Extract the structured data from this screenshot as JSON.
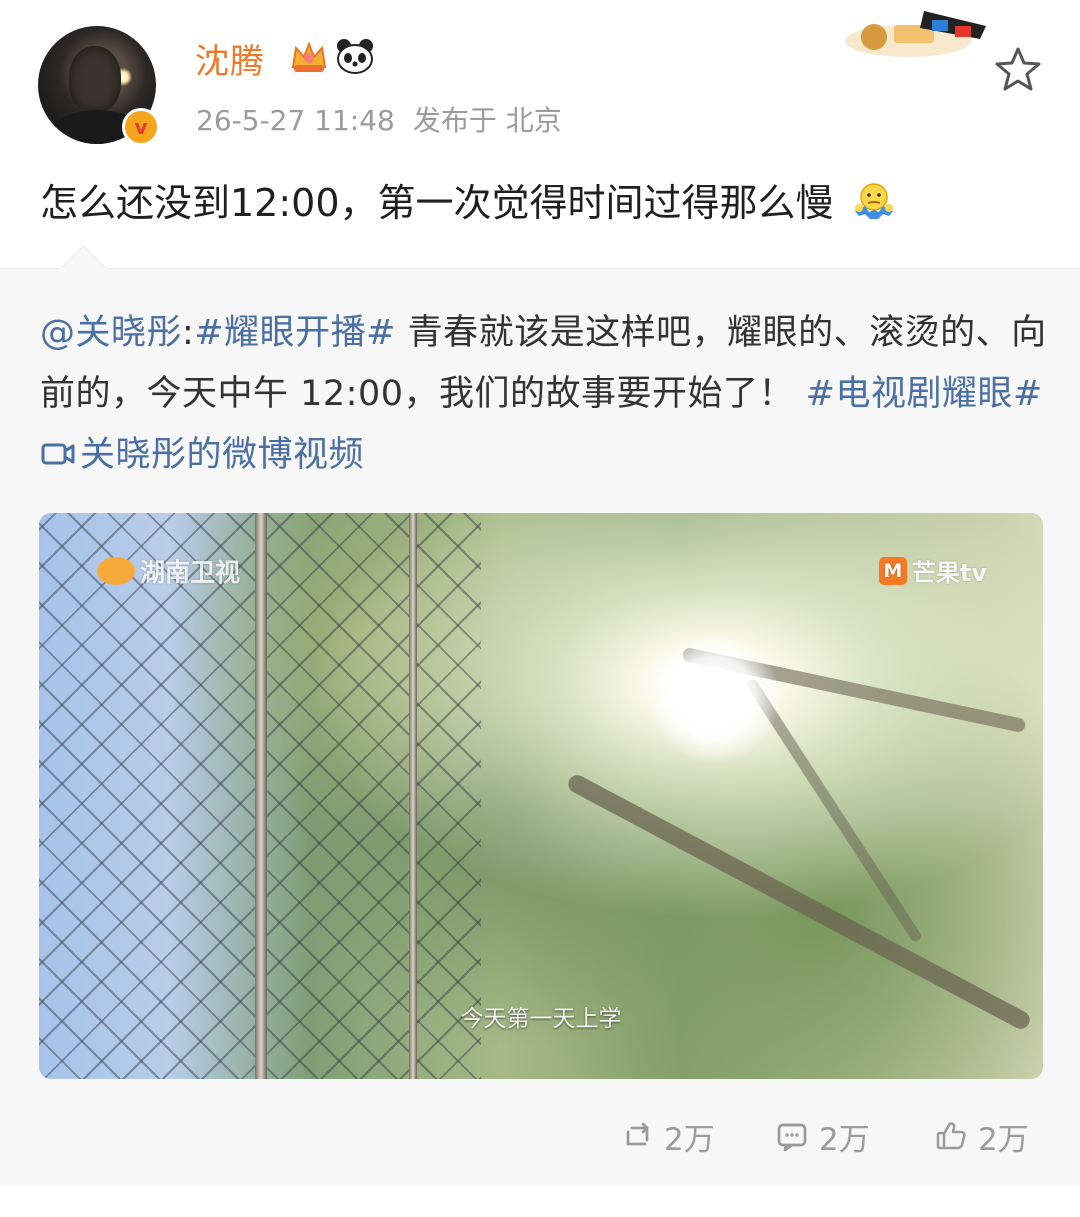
{
  "post": {
    "author": "沈腾",
    "timestamp": "26-5-27 11:48",
    "location": "发布于 北京",
    "content": "怎么还没到12:00，第一次觉得时间过得那么慢"
  },
  "repost": {
    "mention": "@关晓彤",
    "colon": ":",
    "hashtag_1": "#耀眼开播#",
    "text_1": " 青春就该是这样吧，耀眼的、滚烫的、向前的，今天中午 12:00，我们的故事要开始了！",
    "hashtag_2": "#电视剧耀眼#",
    "video_link": "关晓彤的微博视频"
  },
  "video": {
    "watermark_left": "湖南卫视",
    "watermark_right": "芒果tv",
    "subtitle": "今天第一天上学"
  },
  "actions": {
    "repost_count": "2万",
    "comment_count": "2万",
    "like_count": "2万"
  },
  "colors": {
    "username": "#ee7a27",
    "link": "#4a6fa5",
    "muted": "#9b9b9b",
    "repost_bg": "#f7f7f7"
  },
  "icons": {
    "verified": "verified-badge-icon",
    "crown": "crown-icon",
    "panda": "panda-icon",
    "favorite": "star-icon",
    "emoji": "shrug-icon",
    "video": "video-link-icon",
    "repost": "repost-icon",
    "comment": "comment-icon",
    "like": "like-icon"
  }
}
